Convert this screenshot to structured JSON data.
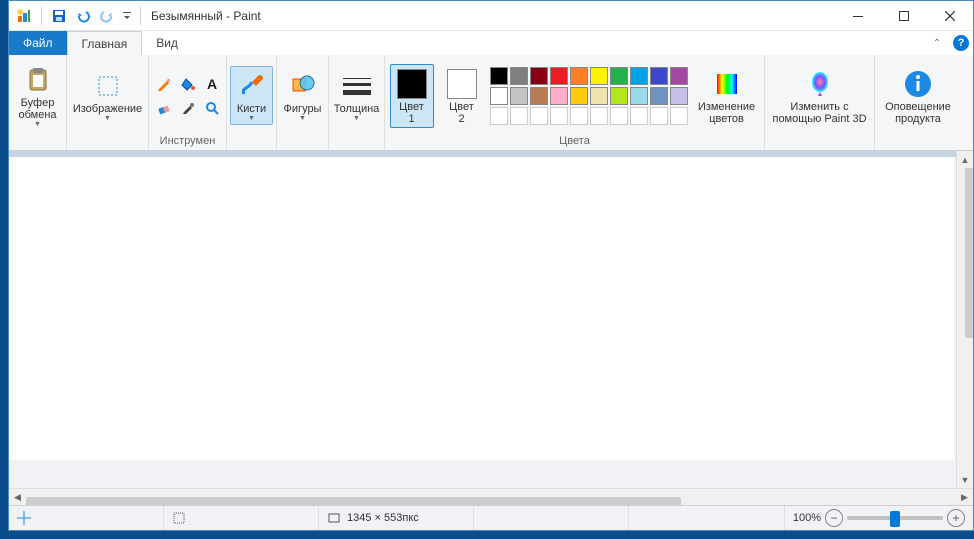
{
  "title": "Безымянный - Paint",
  "tabs": {
    "file": "Файл",
    "home": "Главная",
    "view": "Вид"
  },
  "ribbon": {
    "clipboard": {
      "label": "Буфер\nобмена"
    },
    "image": {
      "label": "Изображение"
    },
    "tools": {
      "label": "Инструмен"
    },
    "brushes": {
      "label": "Кисти"
    },
    "shapes": {
      "label": "Фигуры"
    },
    "thickness": {
      "label": "Толщина"
    },
    "color1": {
      "label": "Цвет\n1"
    },
    "color2": {
      "label": "Цвет\n2"
    },
    "edit_colors": {
      "label": "Изменение\nцветов"
    },
    "colors_group": "Цвета",
    "paint3d": {
      "label": "Изменить с\nпомощью Paint 3D"
    },
    "alert": {
      "label": "Оповещение\nпродукта"
    }
  },
  "colors": {
    "current1": "#000000",
    "current2": "#ffffff",
    "row1": [
      "#000000",
      "#7f7f7f",
      "#880015",
      "#ed1c24",
      "#ff7f27",
      "#fff200",
      "#22b14c",
      "#00a2e8",
      "#3f48cc",
      "#a349a4"
    ],
    "row2": [
      "#ffffff",
      "#c3c3c3",
      "#b97a57",
      "#ffaec9",
      "#ffc90e",
      "#efe4b0",
      "#b5e61d",
      "#99d9ea",
      "#7092be",
      "#c8bfe7"
    ]
  },
  "status": {
    "dimensions": "1345 × 553пкс",
    "zoom": "100%"
  }
}
